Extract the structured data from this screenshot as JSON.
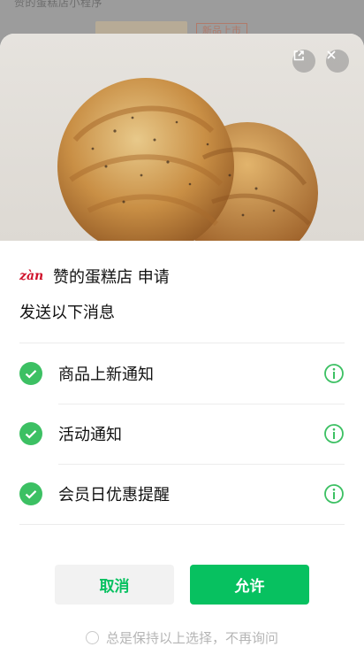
{
  "background": {
    "title": "赞的蛋糕店小程序",
    "tag": "新品上市"
  },
  "sheet": {
    "app_logo_text": "zàn",
    "app_title": "赞的蛋糕店 申请",
    "subtitle": "发送以下消息",
    "share_icon": "share-icon",
    "close_icon": "close-icon",
    "items": [
      {
        "label": "商品上新通知",
        "checked": true,
        "info_icon": "info-icon"
      },
      {
        "label": "活动通知",
        "checked": true,
        "info_icon": "info-icon"
      },
      {
        "label": "会员日优惠提醒",
        "checked": true,
        "info_icon": "info-icon"
      }
    ],
    "cancel_label": "取消",
    "allow_label": "允许",
    "remember_label": "总是保持以上选择，不再询问"
  },
  "colors": {
    "accent": "#07c160",
    "check": "#3cc063",
    "brand": "#d0112b"
  }
}
